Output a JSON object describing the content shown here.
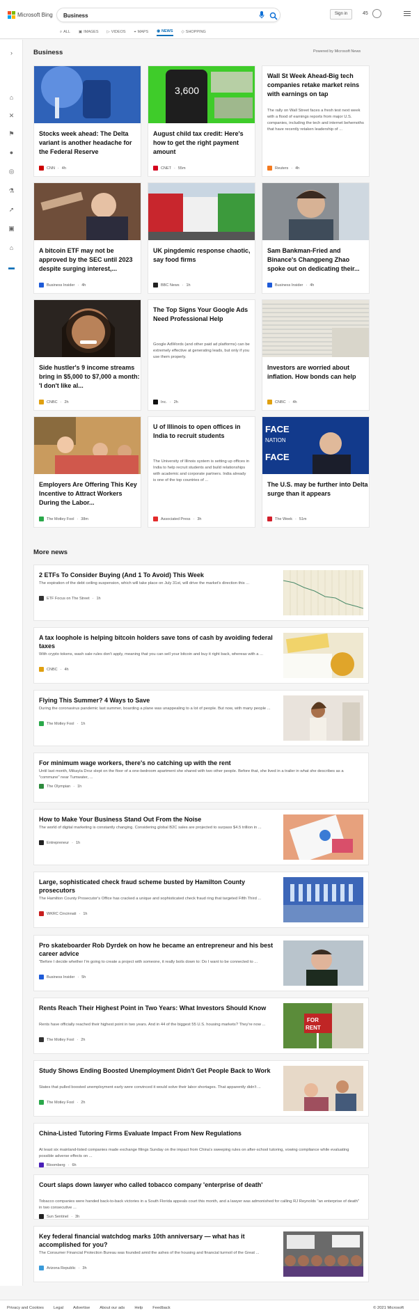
{
  "header": {
    "logo_text": "Microsoft Bing",
    "search_value": "Business",
    "signin_label": "Sign in",
    "rewards_points": "45",
    "logo_colors": [
      "#f25022",
      "#7fba00",
      "#00a4ef",
      "#ffb900"
    ]
  },
  "scopes": [
    {
      "label": "ALL",
      "icon": "search-icon"
    },
    {
      "label": "IMAGES",
      "icon": "image-icon"
    },
    {
      "label": "VIDEOS",
      "icon": "video-icon"
    },
    {
      "label": "MAPS",
      "icon": "map-pin-icon"
    },
    {
      "label": "NEWS",
      "icon": "news-icon"
    },
    {
      "label": "SHOPPING",
      "icon": "tag-icon"
    }
  ],
  "rail_icons": [
    "chevron-right-icon",
    "home-icon",
    "sports-icon",
    "flag-icon",
    "location-icon",
    "globe-icon",
    "science-icon",
    "rocket-icon",
    "entertainment-icon",
    "bank-icon",
    "card-icon"
  ],
  "business": {
    "title": "Business",
    "powered_by": "Powered by Microsoft News",
    "cards": [
      {
        "title": "Stocks week ahead: The Delta variant is another headache for the Federal Reserve",
        "source": "CNN",
        "time": "4h",
        "src_color": "#cc0000",
        "img": "vaccine"
      },
      {
        "title": "August child tax credit: Here's how to get the right payment amount",
        "source": "CNET",
        "time": "55m",
        "src_color": "#d4001d",
        "img": "calculator"
      },
      {
        "title": "Wall St Week Ahead-Big tech companies retake market reins with earnings on tap",
        "snippet": "The rally on Wall Street faces a fresh test next week with a flood of earnings reports from major U.S. companies, including the tech and internet behemoths that have recently retaken leadership of ...",
        "source": "Reuters",
        "time": "4h",
        "src_color": "#f47a1f",
        "img": ""
      },
      {
        "title": "A bitcoin ETF may not be approved by the SEC until 2023 despite surging interest,...",
        "source": "Business Insider",
        "time": "4h",
        "src_color": "#1e5bd8",
        "img": "sec"
      },
      {
        "title": "UK pingdemic response chaotic, say food firms",
        "source": "BBC News",
        "time": "1h",
        "src_color": "#222222",
        "img": "trucks"
      },
      {
        "title": "Sam Bankman-Fried and Binance's Changpeng Zhao spoke out on dedicating their...",
        "source": "Business Insider",
        "time": "4h",
        "src_color": "#1e5bd8",
        "img": "sbf"
      },
      {
        "title": "Side hustler's 9 income streams bring in $5,000 to $7,000 a month: 'I don't like al...",
        "source": "CNBC",
        "time": "2h",
        "src_color": "#e0a010",
        "img": "woman"
      },
      {
        "title": "The Top Signs Your Google Ads Need Professional Help",
        "snippet": "Google AdWords (and other paid ad platforms) can be extremely effective at generating leads, but only if you use them properly.",
        "source": "Inc.",
        "time": "2h",
        "src_color": "#111111",
        "img": ""
      },
      {
        "title": "Investors are worried about inflation. How bonds can help",
        "source": "CNBC",
        "time": "4h",
        "src_color": "#e0a010",
        "img": "paper"
      },
      {
        "title": "Employers Are Offering This Key Incentive to Attract Workers During the Labor...",
        "source": "The Motley Fool",
        "time": "38m",
        "src_color": "#2aa84a",
        "img": "kids"
      },
      {
        "title": "U of Illinois to open offices in India to recruit students",
        "snippet": "The University of Illinois system is setting up offices in India to help recruit students and build relationships with academic and corporate partners. India already is one of the top countries of ...",
        "source": "Associated Press",
        "time": "3h",
        "src_color": "#e32b2b",
        "img": ""
      },
      {
        "title": "The U.S. may be further into Delta surge than it appears",
        "source": "The Week",
        "time": "51m",
        "src_color": "#d21f2b",
        "img": "face"
      }
    ]
  },
  "more_news": {
    "title": "More news",
    "items": [
      {
        "title": "2 ETFs To Consider Buying (And 1 To Avoid) This Week",
        "snippet": "The expiration of the debt ceiling suspension, which will take place on July 31st, will drive the market's direction this ...",
        "source": "ETF Focus on The Street",
        "time": "1h",
        "src_color": "#333333",
        "img": "chart"
      },
      {
        "title": "A tax loophole is helping bitcoin holders save tons of cash by avoiding federal taxes",
        "snippet": "With crypto tokens, wash sale rules don't apply, meaning that you can sell your bitcoin and buy it right back, whereas with a ...",
        "source": "CNBC",
        "time": "4h",
        "src_color": "#e0a010",
        "img": "tax"
      },
      {
        "title": "Flying This Summer? 4 Ways to Save",
        "snippet": "During the coronavirus pandemic last summer, boarding a plane was unappealing to a lot of people. But now, with many people ...",
        "source": "The Motley Fool",
        "time": "1h",
        "src_color": "#2aa84a",
        "img": "traveler"
      },
      {
        "title": "For minimum wage workers, there's no catching up with the rent",
        "snippet": "Until last month, Mikayla Droz slept on the floor of a one-bedroom apartment she shared with two other people. Before that, she lived in a trailer in what she describes as a \"commune\" near Tumwater, ...",
        "source": "The Olympian",
        "time": "1h",
        "src_color": "#2e8b3d",
        "img": ""
      },
      {
        "title": "How to Make Your Business Stand Out From the Noise",
        "snippet": "The world of digital marketing is constantly changing. Considering global B2C sales are projected to surpass $4.5 trillion in ...",
        "source": "Entrepreneur",
        "time": "1h",
        "src_color": "#222222",
        "img": "desk"
      },
      {
        "title": "Large, sophisticated check fraud scheme busted by Hamilton County prosecutors",
        "snippet": "The Hamilton County Prosecutor's Office has cracked a unique and sophisticated check fraud ring that targeted Fifth Third ...",
        "source": "WKRC Cincinnati",
        "time": "1h",
        "src_color": "#c81e1e",
        "img": "building"
      },
      {
        "title": "Pro skateboarder Rob Dyrdek on how he became an entrepreneur and his best career advice",
        "snippet": "\"Before I decide whether I'm going to create a project with someone, it really boils down to: Do I want to be connected to ...",
        "source": "Business Insider",
        "time": "5h",
        "src_color": "#1e5bd8",
        "img": "man"
      },
      {
        "title": "Rents Reach Their Highest Point in Two Years: What Investors Should Know",
        "snippet": "Rents have officially reached their highest point in two years. And in 44 of the biggest 55 U.S. housing markets? They're now ...",
        "source": "The Motley Fool",
        "time": "2h",
        "src_color": "#333333",
        "img": "forrent"
      },
      {
        "title": "Study Shows Ending Boosted Unemployment Didn't Get People Back to Work",
        "snippet": "States that pulled boosted unemployment early were convinced it would solve their labor shortages. That apparently didn't ...",
        "source": "The Motley Fool",
        "time": "2h",
        "src_color": "#2aa84a",
        "img": "kitchen"
      },
      {
        "title": "China-Listed Tutoring Firms Evaluate Impact From New Regulations",
        "snippet": "At least six mainland-listed companies made exchange filings Sunday on the impact from China's sweeping rules on after-school tutoring, vowing compliance while evaluating possible adverse effects on ...",
        "source": "Bloomberg",
        "time": "6h",
        "src_color": "#4a1fb8",
        "img": ""
      },
      {
        "title": "Court slaps down lawyer who called tobacco company 'enterprise of death'",
        "snippet": "Tobacco companies were handed back-to-back victories in a South Florida appeals court this month, and a lawyer was admonished for calling RJ Reynolds \"an enterprise of death\" in two consecutive ...",
        "source": "Sun Sentinel",
        "time": "3h",
        "src_color": "#222222",
        "img": ""
      },
      {
        "title": "Key federal financial watchdog marks 10th anniversary — what has it accomplished for you?",
        "snippet": "The Consumer Financial Protection Bureau was founded amid the ashes of the housing and financial turmoil of the Great ...",
        "source": "Arizona Republic",
        "time": "3h",
        "src_color": "#3a9ad9",
        "img": "protest"
      }
    ]
  },
  "footer": {
    "links": [
      "Privacy and Cookies",
      "Legal",
      "Advertise",
      "About our ads",
      "Help",
      "Feedback"
    ],
    "copyright": "© 2021 Microsoft"
  }
}
